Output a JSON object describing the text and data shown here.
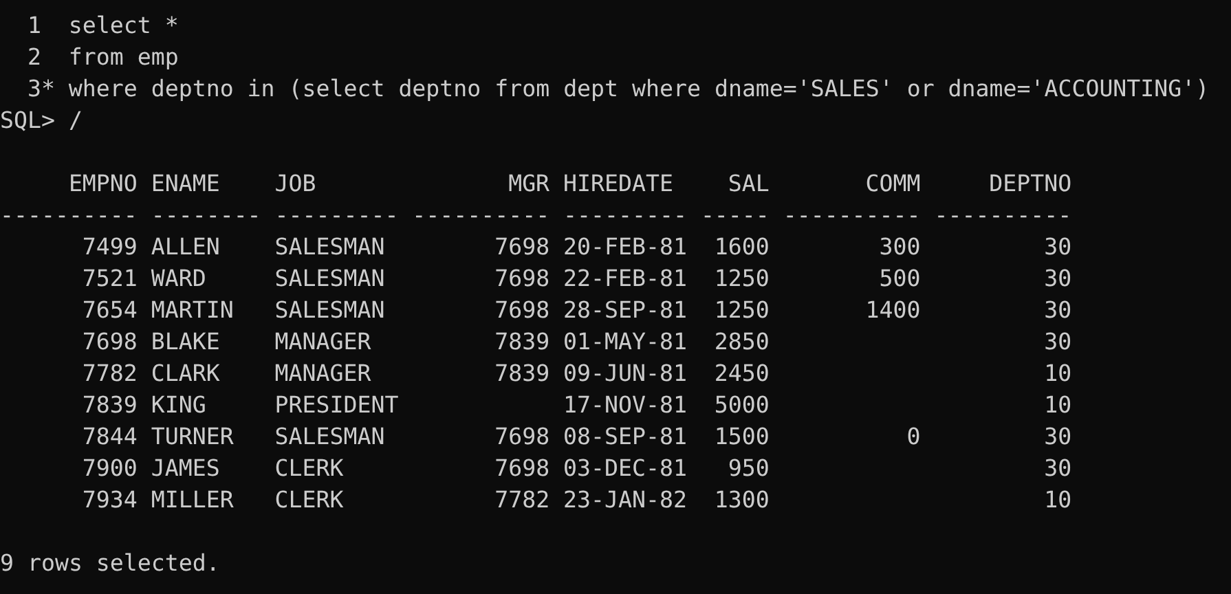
{
  "terminal": {
    "script_lines": [
      {
        "number": "1",
        "text": "select *"
      },
      {
        "number": "2",
        "text": "from emp"
      },
      {
        "number": "3*",
        "text": "where deptno in (select deptno from dept where dname='SALES' or dname='ACCOUNTING')"
      }
    ],
    "prompt": "SQL>",
    "command": "/",
    "table": {
      "columns": [
        {
          "heading": "EMPNO",
          "rule": "----------",
          "kind": "number"
        },
        {
          "heading": "ENAME",
          "rule": "--------",
          "kind": "text"
        },
        {
          "heading": "JOB",
          "rule": "---------",
          "kind": "text"
        },
        {
          "heading": "MGR",
          "rule": "----------",
          "kind": "number"
        },
        {
          "heading": "HIREDATE",
          "rule": "---------",
          "kind": "text"
        },
        {
          "heading": "SAL",
          "rule": "-----",
          "kind": "number"
        },
        {
          "heading": "COMM",
          "rule": "----------",
          "kind": "number"
        },
        {
          "heading": "DEPTNO",
          "rule": "----------",
          "kind": "number"
        }
      ],
      "rows": [
        [
          "7499",
          "ALLEN",
          "SALESMAN",
          "7698",
          "20-FEB-81",
          "1600",
          "300",
          "30"
        ],
        [
          "7521",
          "WARD",
          "SALESMAN",
          "7698",
          "22-FEB-81",
          "1250",
          "500",
          "30"
        ],
        [
          "7654",
          "MARTIN",
          "SALESMAN",
          "7698",
          "28-SEP-81",
          "1250",
          "1400",
          "30"
        ],
        [
          "7698",
          "BLAKE",
          "MANAGER",
          "7839",
          "01-MAY-81",
          "2850",
          null,
          "30"
        ],
        [
          "7782",
          "CLARK",
          "MANAGER",
          "7839",
          "09-JUN-81",
          "2450",
          null,
          "10"
        ],
        [
          "7839",
          "KING",
          "PRESIDENT",
          null,
          "17-NOV-81",
          "5000",
          null,
          "10"
        ],
        [
          "7844",
          "TURNER",
          "SALESMAN",
          "7698",
          "08-SEP-81",
          "1500",
          "0",
          "30"
        ],
        [
          "7900",
          "JAMES",
          "CLERK",
          "7698",
          "03-DEC-81",
          "950",
          null,
          "30"
        ],
        [
          "7934",
          "MILLER",
          "CLERK",
          "7782",
          "23-JAN-82",
          "1300",
          null,
          "10"
        ]
      ]
    },
    "feedback": "9 rows selected."
  }
}
